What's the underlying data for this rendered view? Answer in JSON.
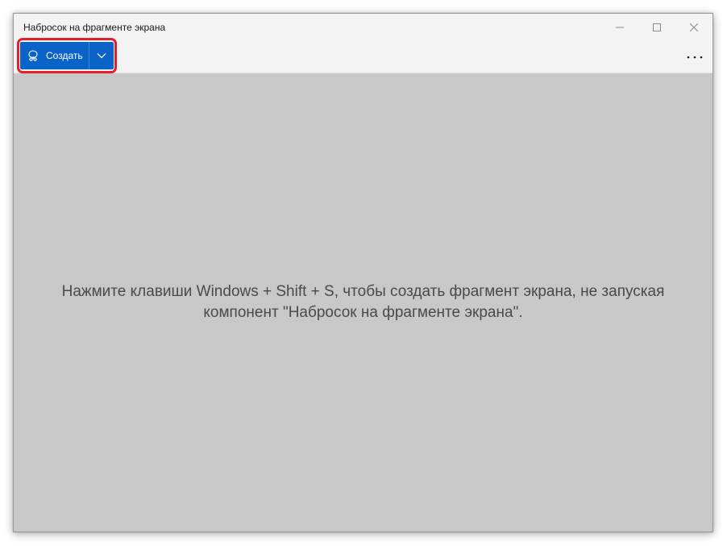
{
  "window": {
    "title": "Набросок на фрагменте экрана"
  },
  "title_controls": {
    "minimize_icon": "minimize-icon",
    "maximize_icon": "maximize-icon",
    "close_icon": "close-icon"
  },
  "toolbar": {
    "create_label": "Создать",
    "create_icon": "snip-icon",
    "dropdown_icon": "chevron-down-icon",
    "more_icon": "more-icon"
  },
  "content": {
    "hint_line1": "Нажмите клавиши Windows + Shift + S, чтобы создать фрагмент экрана, не запуская",
    "hint_line2": "компонент \"Набросок на фрагменте экрана\"."
  },
  "colors": {
    "accent": "#0a64c8",
    "highlight": "#e0202a",
    "content_bg": "#c8c8c8",
    "chrome_bg": "#f3f3f3"
  }
}
